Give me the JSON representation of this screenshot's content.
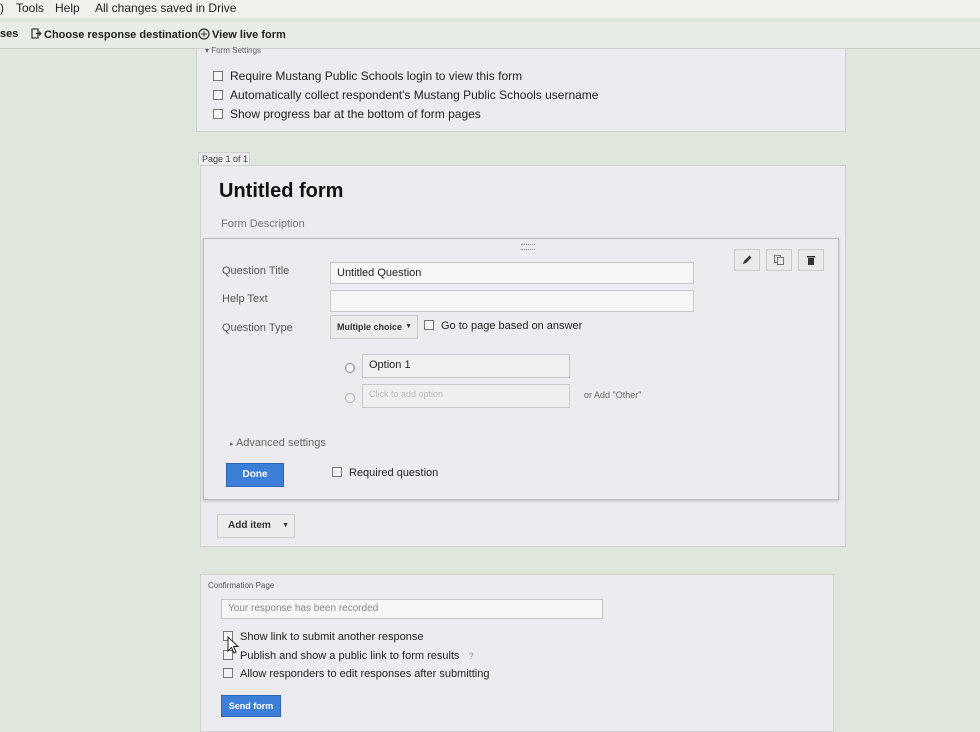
{
  "menubar": {
    "prefix": ")",
    "tools": "Tools",
    "help": "Help",
    "status": "All changes saved in Drive"
  },
  "toolbar": {
    "partial": "ses",
    "choose_destination": "Choose response destination",
    "view_live_form": "View live form"
  },
  "form_settings": {
    "header": "Form Settings",
    "options": [
      "Require Mustang Public Schools login to view this form",
      "Automatically collect respondent's Mustang Public Schools username",
      "Show progress bar at the bottom of form pages"
    ]
  },
  "page": {
    "tab": "Page 1 of 1",
    "title": "Untitled form",
    "description": "Form Description"
  },
  "question": {
    "title_label": "Question Title",
    "title_value": "Untitled Question",
    "help_label": "Help Text",
    "help_value": "",
    "type_label": "Question Type",
    "type_value": "Multiple choice",
    "goto_label": "Go to page based on answer",
    "option1": "Option 1",
    "add_option_placeholder": "Click to add option",
    "add_other": "or Add \"Other\"",
    "advanced": "Advanced settings",
    "done": "Done",
    "required": "Required question"
  },
  "add_item": "Add item",
  "confirmation": {
    "header": "Confirmation Page",
    "message": "Your response has been recorded",
    "options": [
      "Show link to submit another response",
      "Publish and show a public link to form results",
      "Allow responders to edit responses after submitting"
    ],
    "help_mark": "?",
    "send": "Send form"
  }
}
